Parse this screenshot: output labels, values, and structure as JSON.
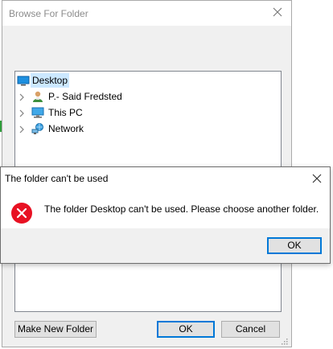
{
  "browse_dialog": {
    "title": "Browse For Folder",
    "tree": [
      {
        "label": "Desktop",
        "icon": "desktop-icon",
        "selected": true,
        "expandable": false
      },
      {
        "label": "P.- Said Fredsted",
        "icon": "user-folder-icon",
        "selected": false,
        "expandable": true
      },
      {
        "label": "This PC",
        "icon": "computer-icon",
        "selected": false,
        "expandable": true
      },
      {
        "label": "Network",
        "icon": "network-icon",
        "selected": false,
        "expandable": true
      }
    ],
    "buttons": {
      "make_new_folder": "Make New Folder",
      "ok": "OK",
      "cancel": "Cancel"
    }
  },
  "error_dialog": {
    "title": "The folder can't be used",
    "message": "The folder Desktop can't be used. Please choose another folder.",
    "ok": "OK",
    "icon": "error-icon"
  },
  "colors": {
    "accent": "#0078d7",
    "selection": "#cce8ff",
    "error_red": "#e81123"
  }
}
